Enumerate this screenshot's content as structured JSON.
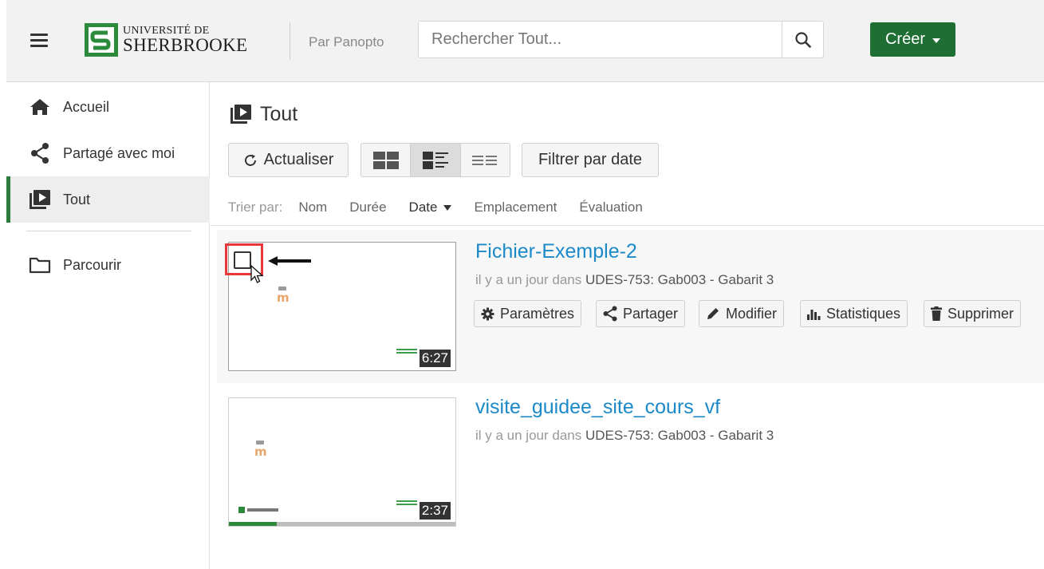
{
  "header": {
    "logo_line1": "UNIVERSITÉ DE",
    "logo_line2": "SHERBROOKE",
    "by_panopto": "Par Panopto",
    "search_placeholder": "Rechercher Tout...",
    "create_label": "Créer"
  },
  "sidebar": {
    "items": [
      {
        "label": "Accueil",
        "icon": "home-icon"
      },
      {
        "label": "Partagé avec moi",
        "icon": "share-icon"
      },
      {
        "label": "Tout",
        "icon": "video-library-icon",
        "active": true
      },
      {
        "label": "Parcourir",
        "icon": "folder-icon"
      }
    ]
  },
  "main": {
    "title": "Tout",
    "refresh_label": "Actualiser",
    "filter_label": "Filtrer par date",
    "views": [
      {
        "name": "thumbnail-view",
        "active": false
      },
      {
        "name": "detail-view",
        "active": true
      },
      {
        "name": "list-view",
        "active": false
      }
    ],
    "sort": {
      "label": "Trier par:",
      "options": [
        "Nom",
        "Durée",
        "Date",
        "Emplacement",
        "Évaluation"
      ],
      "active": "Date"
    }
  },
  "sessions": [
    {
      "title": "Fichier-Exemple-2",
      "time": "il y a un jour dans",
      "folder": "UDES-753: Gab003 - Gabarit 3",
      "duration": "6:27",
      "actions": [
        "Paramètres",
        "Partager",
        "Modifier",
        "Statistiques",
        "Supprimer"
      ]
    },
    {
      "title": "visite_guidee_site_cours_vf",
      "time": "il y a un jour dans",
      "folder": "UDES-753: Gab003 - Gabarit 3",
      "duration": "2:37",
      "progress": 0.21
    }
  ],
  "colors": {
    "brand_green": "#1f6f35",
    "link_blue": "#1c8ac9",
    "highlight_red": "#e8383b"
  }
}
